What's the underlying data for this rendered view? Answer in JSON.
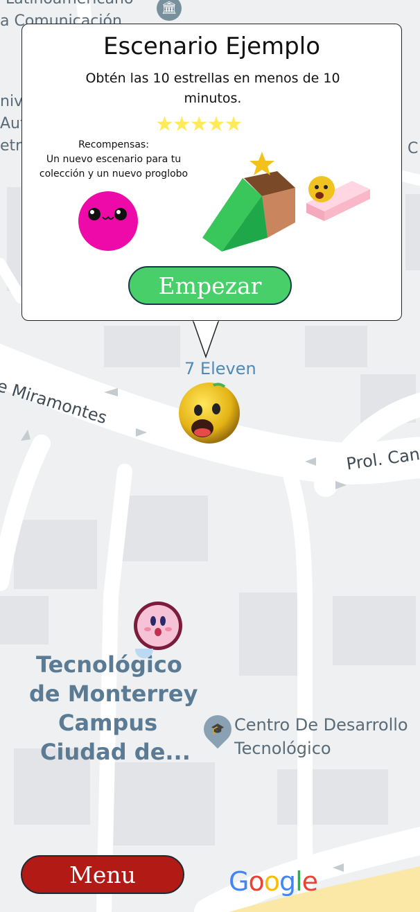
{
  "popup": {
    "title": "Escenario Ejemplo",
    "description": "Obtén las 10 estrellas en menos de 10 minutos.",
    "stars": "★★★★★",
    "rewards_title": "Recompensas:",
    "rewards_text": "Un nuevo escenario para tu colección y un nuevo proglobo",
    "start_button": "Empezar"
  },
  "map": {
    "labels": {
      "top": "Latinoamericano",
      "top2": "a Comunicación",
      "left1": "niv",
      "left2": "Aut",
      "left3": "etro",
      "right_c": "C",
      "seven_eleven": "7 Eleven",
      "miramontes": "de Miramontes",
      "prol_can": "Prol. Can",
      "tec_line1": "Tecnológico",
      "tec_line2": "de Monterrey",
      "tec_line3": "Campus",
      "tec_line4": "Ciudad de...",
      "centro_line1": "Centro De Desarrollo",
      "centro_line2": "Tecnológico"
    },
    "colors": {
      "background": "#eef0f2",
      "road": "#ffffff",
      "building": "#e2e4e7",
      "label": "#5a7b93"
    }
  },
  "menu_button": "Menu",
  "google_logo": {
    "letters": [
      "G",
      "o",
      "o",
      "g",
      "l",
      "e"
    ],
    "colors": [
      "#4285f4",
      "#ea4335",
      "#fbbc05",
      "#4285f4",
      "#34a853",
      "#ea4335"
    ]
  },
  "icons": [
    "landmark-icon",
    "education-pin-icon",
    "pink-balloon-icon",
    "cube-scenario-icon",
    "yellow-face-icon",
    "kirby-icon",
    "star-icon"
  ]
}
